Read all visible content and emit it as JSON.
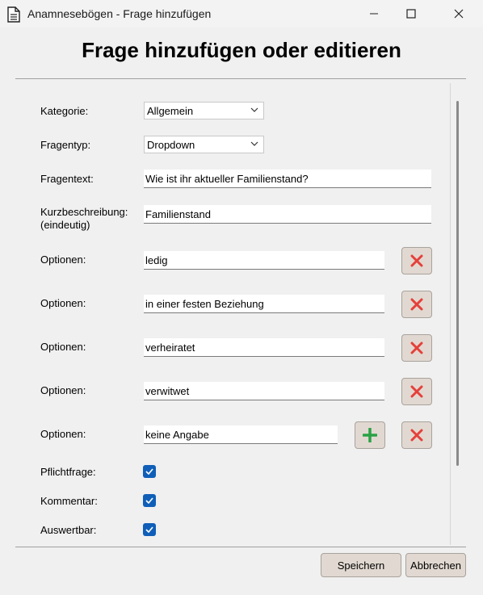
{
  "window": {
    "title": "Anamnesebögen - Frage hinzufügen",
    "minimize_icon": "minimize-icon",
    "maximize_icon": "maximize-icon",
    "close_icon": "close-icon"
  },
  "heading": "Frage hinzufügen oder editieren",
  "form": {
    "kategorie": {
      "label": "Kategorie:",
      "value": "Allgemein"
    },
    "fragentyp": {
      "label": "Fragentyp:",
      "value": "Dropdown"
    },
    "fragentext": {
      "label": "Fragentext:",
      "value": "Wie ist ihr aktueller Familienstand?"
    },
    "kurzbeschreibung": {
      "label_line1": "Kurzbeschreibung:",
      "label_line2": "(eindeutig)",
      "value": "Familienstand"
    },
    "optionen": [
      {
        "label": "Optionen:",
        "value": "ledig"
      },
      {
        "label": "Optionen:",
        "value": "in einer festen Beziehung"
      },
      {
        "label": "Optionen:",
        "value": "verheiratet"
      },
      {
        "label": "Optionen:",
        "value": "verwitwet"
      },
      {
        "label": "Optionen:",
        "value": "keine Angabe"
      }
    ],
    "pflichtfrage": {
      "label": "Pflichtfrage:",
      "checked": true
    },
    "kommentar": {
      "label": "Kommentar:",
      "checked": true
    },
    "auswertbar": {
      "label": "Auswertbar:",
      "checked": true
    }
  },
  "buttons": {
    "save": "Speichern",
    "cancel": "Abbrechen"
  },
  "colors": {
    "remove": "#e5403a",
    "add": "#2aa145",
    "checkbox": "#0f5fb8"
  }
}
